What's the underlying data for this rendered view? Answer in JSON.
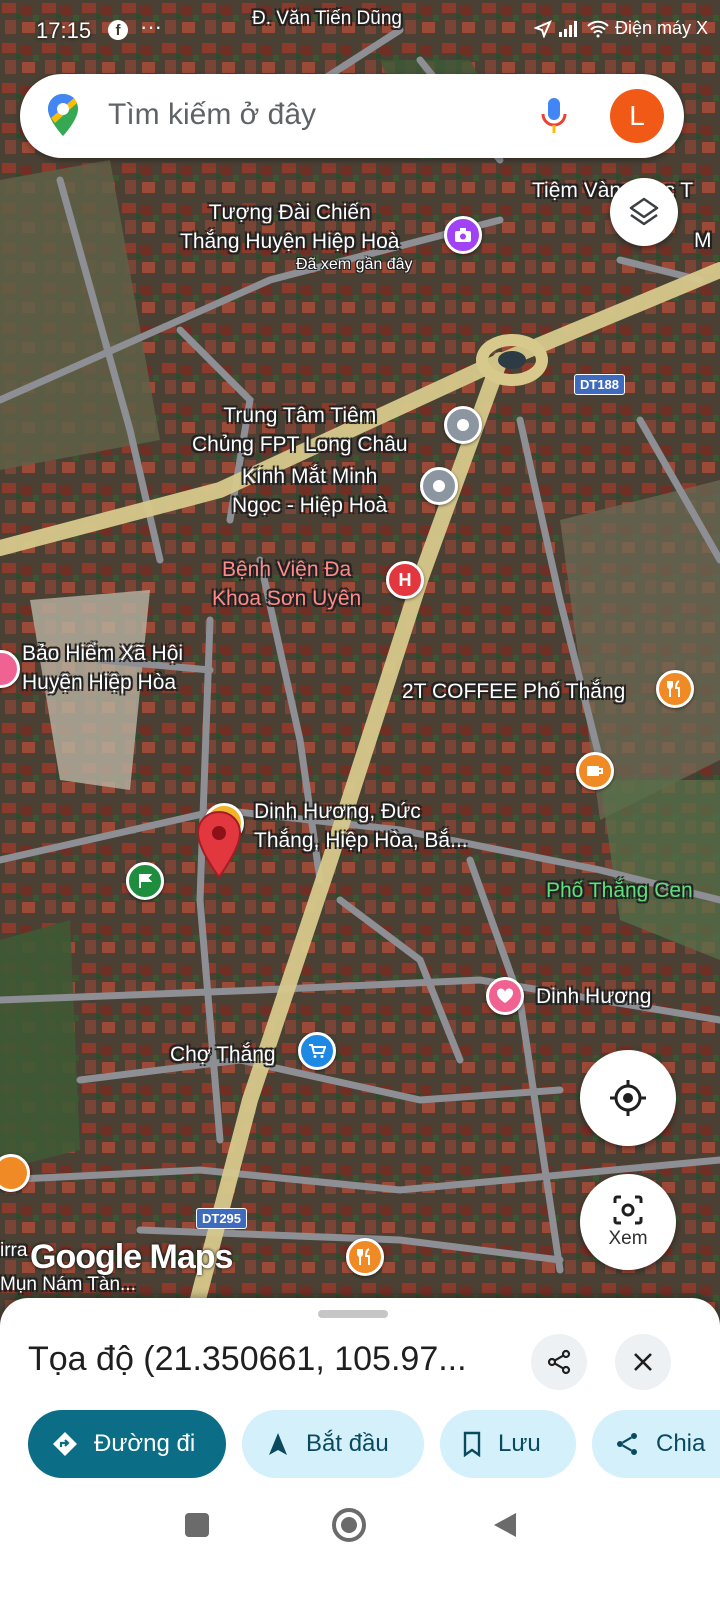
{
  "status_bar": {
    "time": "17:15",
    "facebook_icon": "f",
    "more": "···",
    "right_text": "Điện máy X"
  },
  "search": {
    "placeholder": "Tìm kiếm ở đây",
    "avatar_letter": "L"
  },
  "map": {
    "labels": {
      "road_top": "Đ. Văn Tiến Dũng",
      "tiem_vang": "Tiệm Vàng Bạc T",
      "m_right": "M",
      "tuong_dai": "Tượng Đài Chiến\nThắng Huyện Hiệp Hoà",
      "tuong_dai_sub": "Đã xem gần đây",
      "fpt": "Trung Tâm Tiêm\nChủng FPT Long Châu",
      "kinh_mat": "Kính Mắt Minh\nNgọc - Hiệp Hoà",
      "benh_vien": "Bệnh Viện Đa\nKhoa Sơn Uyên",
      "bao_hiem": "Bảo Hiểm Xã Hội\nHuyện Hiệp Hòa",
      "coffee": "2T COFFEE Phố Thắng",
      "dropped_pin": "Dinh Hương, Đức\nThắng, Hiệp Hòa, Bắ...",
      "pho_thang": "Phố Thắng Cen",
      "dinh_huong": "Dinh Hương",
      "cho_thang": "Chợ Thắng",
      "irra": "irra",
      "mun_nam": "Mụn Nám Tàn..."
    },
    "road_shields": {
      "dt188": "DT188",
      "dt295": "DT295"
    },
    "watermark": "Google Maps",
    "hospital_letter": "H",
    "colors": {
      "main_road": "#d7c98c",
      "pin_red": "#e2373f",
      "pin_grey": "#8c96a0",
      "pin_orange": "#f08a24",
      "pin_pink": "#f06292",
      "pin_blue": "#1e88e5",
      "pin_green": "#1e8e3e",
      "pin_purple": "#a142f4"
    }
  },
  "controls": {
    "lens_label": "Xem"
  },
  "sheet": {
    "title": "Tọa độ (21.350661, 105.97...",
    "actions": {
      "directions": "Đường đi",
      "start": "Bắt đầu",
      "save": "Lưu",
      "share": "Chia"
    }
  }
}
